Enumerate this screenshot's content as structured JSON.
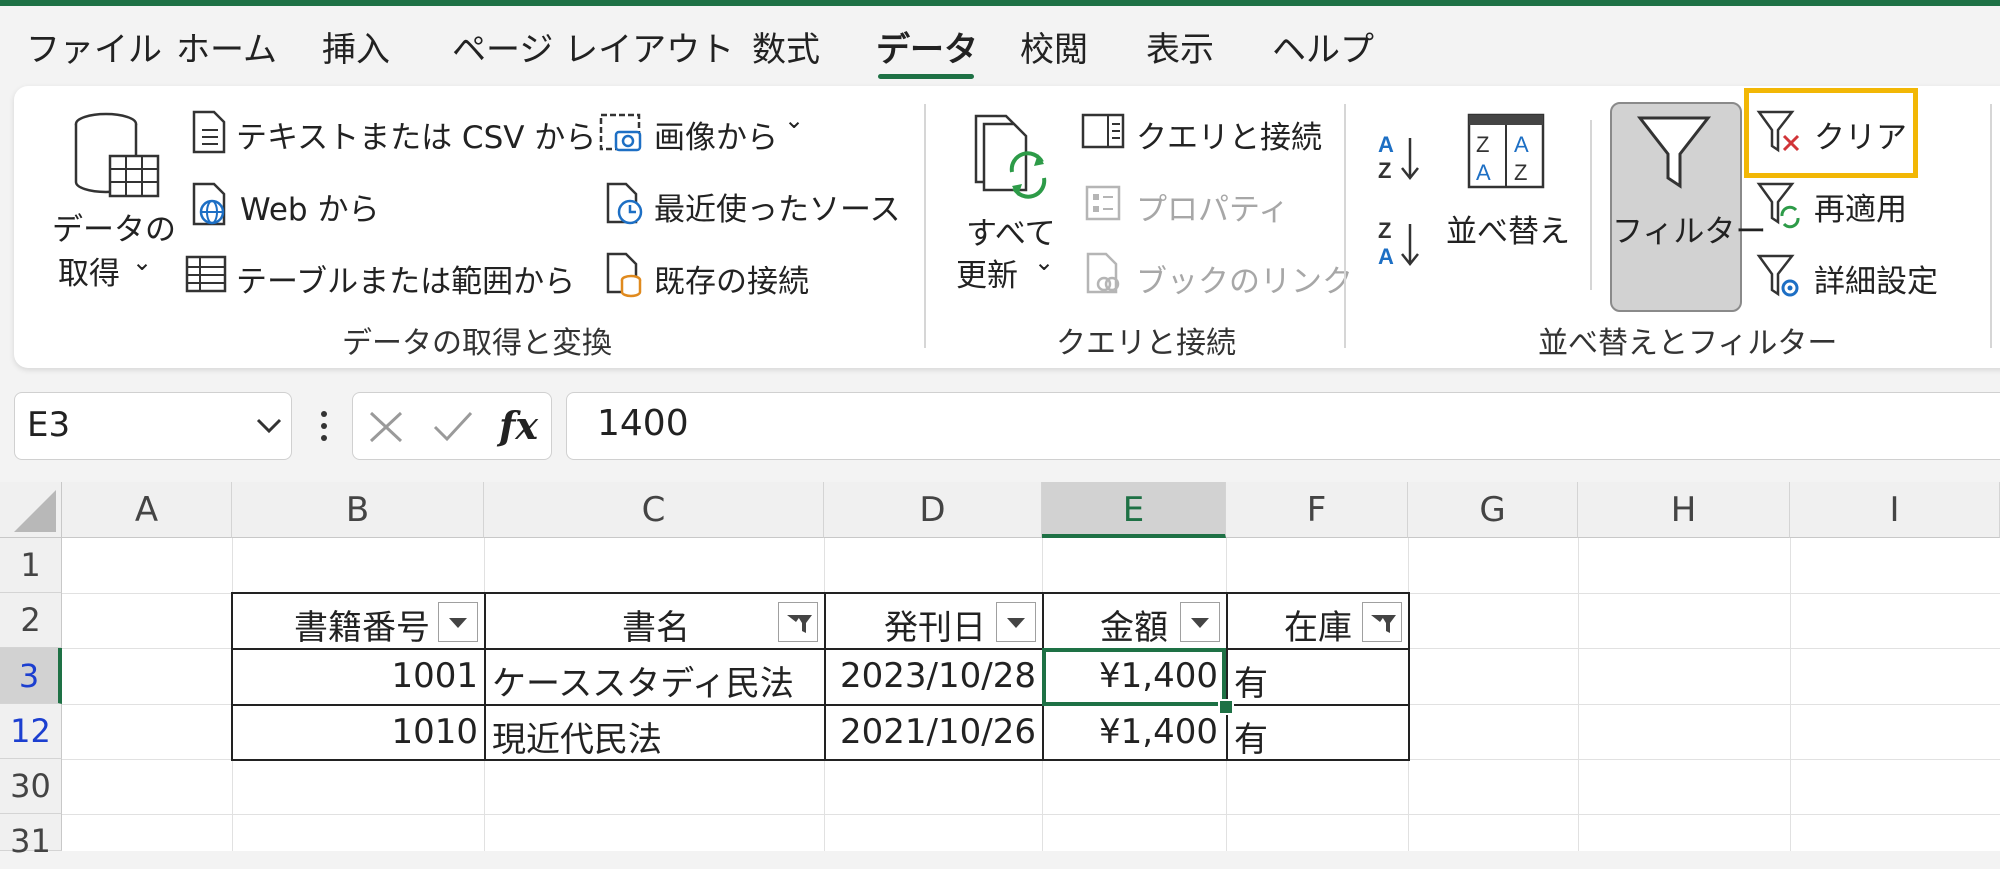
{
  "menu": {
    "tabs": [
      "ファイル",
      "ホーム",
      "挿入",
      "ページ レイアウト",
      "数式",
      "データ",
      "校閲",
      "表示",
      "ヘルプ"
    ],
    "active_tab": "データ"
  },
  "ribbon": {
    "get_data": {
      "get_data_line1": "データの",
      "get_data_line2": "取得",
      "from_text_csv": "テキストまたは CSV から",
      "from_web": "Web から",
      "from_table": "テーブルまたは範囲から",
      "from_picture": "画像から",
      "recent_sources": "最近使ったソース",
      "existing_connections": "既存の接続",
      "group_label": "データの取得と変換"
    },
    "queries": {
      "refresh_line1": "すべて",
      "refresh_line2": "更新",
      "queries_connections": "クエリと接続",
      "properties": "プロパティ",
      "workbook_links": "ブックのリンク",
      "group_label": "クエリと接続"
    },
    "sort_filter": {
      "sort": "並べ替え",
      "filter": "フィルター",
      "clear": "クリア",
      "reapply": "再適用",
      "advanced": "詳細設定",
      "group_label": "並べ替えとフィルター"
    }
  },
  "formula_bar": {
    "name_box": "E3",
    "fx_label": "fx",
    "formula": "1400"
  },
  "sheet": {
    "columns": [
      "A",
      "B",
      "C",
      "D",
      "E",
      "F",
      "G",
      "H",
      "I"
    ],
    "selected_column": "E",
    "rows": [
      "1",
      "2",
      "3",
      "12",
      "30",
      "31"
    ],
    "table": {
      "headers": [
        "書籍番号",
        "書名",
        "発刊日",
        "金額",
        "在庫"
      ],
      "rows": [
        [
          "1001",
          "ケーススタディ民法",
          "2023/10/28",
          "¥1,400",
          "有"
        ],
        [
          "1010",
          "現近代民法",
          "2021/10/26",
          "¥1,400",
          "有"
        ]
      ]
    }
  },
  "colors": {
    "accent_green": "#1e7145",
    "highlight_yellow": "#f2b705",
    "filtered_row_blue": "#1c3fd0"
  }
}
